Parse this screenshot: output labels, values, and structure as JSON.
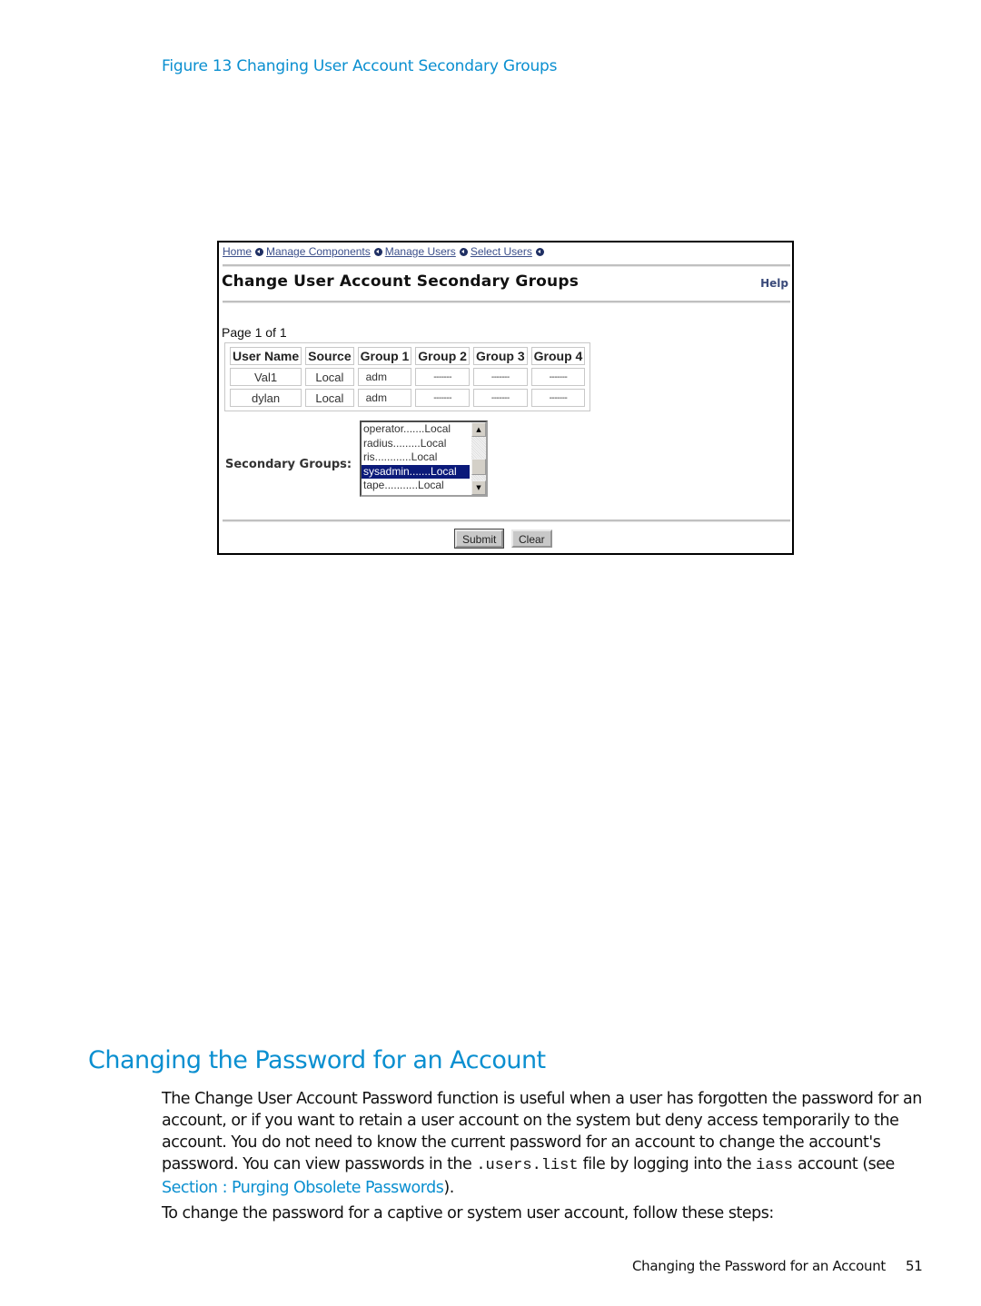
{
  "figure": {
    "caption": "Figure 13 Changing User Account Secondary Groups"
  },
  "screenshot": {
    "breadcrumb": [
      "Home",
      "Manage Components",
      "Manage Users",
      "Select Users"
    ],
    "breadcrumb_separator_icon": "circle-left-arrow-icon",
    "title": "Change User Account Secondary Groups",
    "help_label": "Help",
    "page_info": "Page 1 of 1",
    "table": {
      "headers": [
        "User Name",
        "Source",
        "Group 1",
        "Group 2",
        "Group 3",
        "Group 4"
      ],
      "rows": [
        [
          "Val1",
          "Local",
          "adm",
          "-------",
          "-------",
          "-------"
        ],
        [
          "dylan",
          "Local",
          "adm",
          "-------",
          "-------",
          "-------"
        ]
      ]
    },
    "secondary_groups": {
      "label": "Secondary Groups:",
      "options": [
        {
          "label": "operator.......Local",
          "selected": false
        },
        {
          "label": "radius.........Local",
          "selected": false
        },
        {
          "label": "ris............Local",
          "selected": false
        },
        {
          "label": "sysadmin.......Local",
          "selected": true
        },
        {
          "label": "tape...........Local",
          "selected": false
        }
      ]
    },
    "buttons": {
      "submit": "Submit",
      "clear": "Clear"
    },
    "colors": {
      "link": "#3b4f8a",
      "selection": "#0b1a7a"
    }
  },
  "section": {
    "heading": "Changing the Password for an Account",
    "para1": {
      "text_a": "The Change User Account Password function is useful when a user has forgotten the password for an account, or if you want to retain a user account on the system but deny access temporarily to the account. You do not need to know the current password for an account to change the account's password. You can view passwords in the ",
      "code1": ".users.list",
      "text_b": " file by logging into the ",
      "code2": "iass",
      "text_c": " account (see ",
      "link": "Section : Purging Obsolete Passwords",
      "text_d": ")."
    },
    "para2": "To change the password for a captive or system user account, follow these steps:"
  },
  "footer": {
    "title": "Changing the Password for an Account",
    "page": "51"
  },
  "colors": {
    "accent": "#0a8fd0",
    "text": "#111111"
  }
}
